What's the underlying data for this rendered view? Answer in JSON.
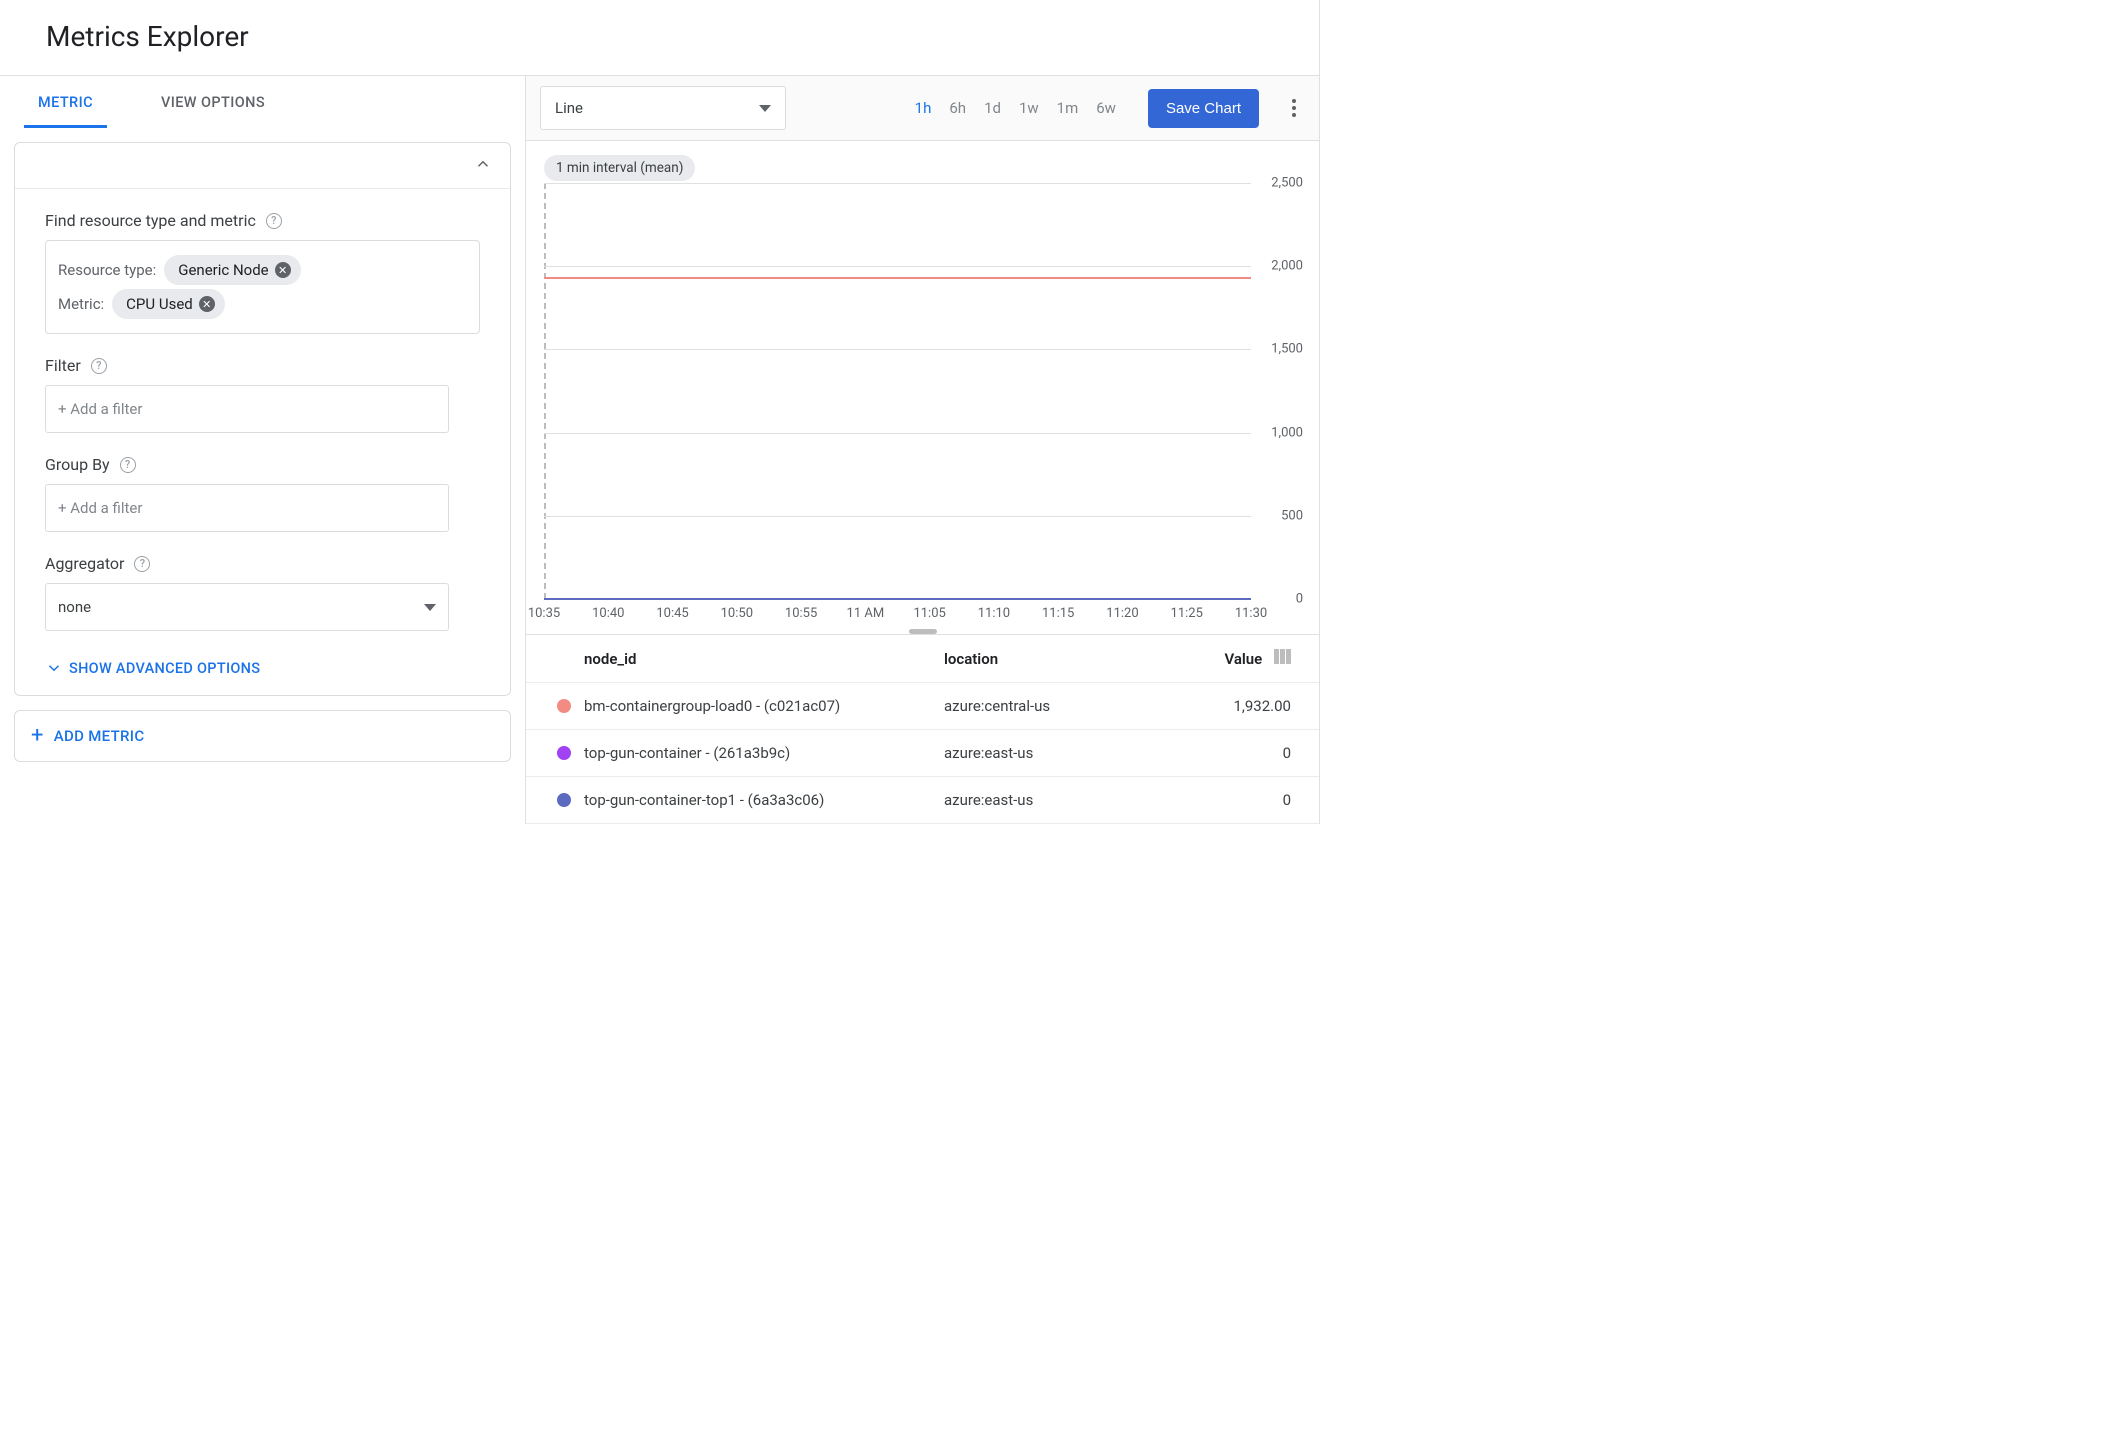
{
  "page_title": "Metrics Explorer",
  "tabs": {
    "metric": "METRIC",
    "view_options": "VIEW OPTIONS"
  },
  "metric_panel": {
    "find_label": "Find resource type and metric",
    "resource_type_label": "Resource type:",
    "resource_type_value": "Generic Node",
    "metric_label": "Metric:",
    "metric_value": "CPU Used",
    "filter_label": "Filter",
    "filter_placeholder": "+ Add a filter",
    "groupby_label": "Group By",
    "groupby_placeholder": "+ Add a filter",
    "aggregator_label": "Aggregator",
    "aggregator_value": "none",
    "show_advanced": "SHOW ADVANCED OPTIONS",
    "add_metric": "ADD METRIC"
  },
  "toolbar": {
    "chart_type": "Line",
    "ranges": [
      "1h",
      "6h",
      "1d",
      "1w",
      "1m",
      "6w"
    ],
    "active_range": "1h",
    "save_label": "Save Chart"
  },
  "chart": {
    "interval_label": "1 min interval (mean)"
  },
  "chart_data": {
    "type": "line",
    "xlabel": "",
    "ylabel": "",
    "ylim": [
      0,
      2500
    ],
    "y_ticks": [
      "0",
      "500",
      "1,000",
      "1,500",
      "2,000",
      "2,500"
    ],
    "x_ticks": [
      "10:35",
      "10:40",
      "10:45",
      "10:50",
      "10:55",
      "11 AM",
      "11:05",
      "11:10",
      "11:15",
      "11:20",
      "11:25",
      "11:30"
    ],
    "series": [
      {
        "name": "bm-containergroup-load0 - (c021ac07)",
        "color": "#f28b82",
        "approx_value": 1932
      },
      {
        "name": "top-gun-container - (261a3b9c)",
        "color": "#a142f4",
        "approx_value": 0
      },
      {
        "name": "top-gun-container-top1 - (6a3a3c06)",
        "color": "#5c6bc0",
        "approx_value": 0
      }
    ]
  },
  "legend": {
    "headers": {
      "nodeid": "node_id",
      "location": "location",
      "value": "Value"
    },
    "rows": [
      {
        "color": "#f28b82",
        "nodeid": "bm-containergroup-load0 - (c021ac07)",
        "location": "azure:central-us",
        "value": "1,932.00"
      },
      {
        "color": "#a142f4",
        "nodeid": "top-gun-container - (261a3b9c)",
        "location": "azure:east-us",
        "value": "0"
      },
      {
        "color": "#5c6bc0",
        "nodeid": "top-gun-container-top1 - (6a3a3c06)",
        "location": "azure:east-us",
        "value": "0"
      }
    ]
  }
}
